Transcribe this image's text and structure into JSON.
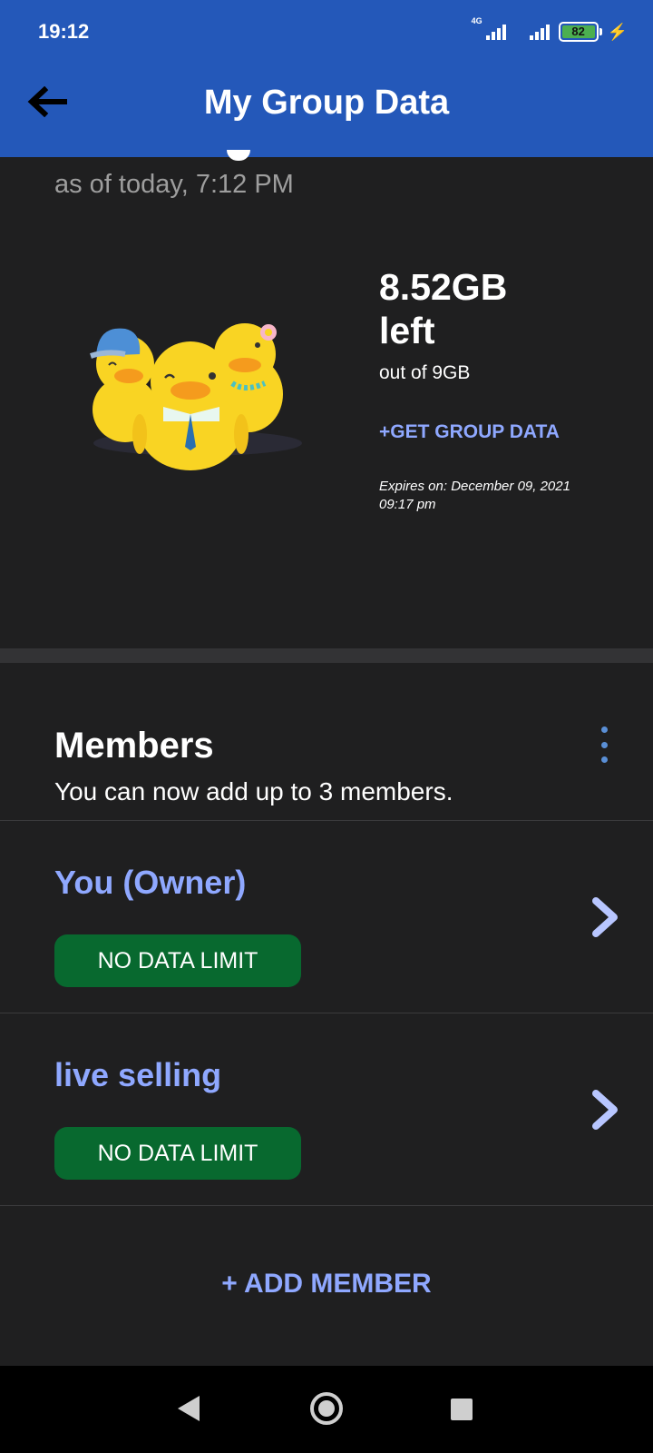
{
  "status_bar": {
    "time": "19:12",
    "network_type": "4G",
    "battery_level": "82"
  },
  "header": {
    "title": "My Group Data",
    "back_icon": "arrow-left-icon"
  },
  "summary": {
    "as_of": "as of today, 7:12 PM",
    "data_left_amount": "8.52GB",
    "data_left_suffix": "left",
    "out_of": "out of 9GB",
    "get_group_data_label": "+GET GROUP DATA",
    "expires": "Expires on: December 09, 2021 09:17 pm",
    "illustration": "three-ducks-illustration"
  },
  "members": {
    "title": "Members",
    "subtitle": "You can now add up to 3 members.",
    "menu_icon": "more-vertical-icon",
    "list": [
      {
        "name": "You (Owner)",
        "limit": "NO DATA LIMIT"
      },
      {
        "name": "live selling",
        "limit": "NO DATA LIMIT"
      }
    ],
    "add_member_label": "+ ADD MEMBER"
  },
  "colors": {
    "header_bg": "#2458b9",
    "page_bg": "#1f1f20",
    "accent_link": "#8fa8ff",
    "pill_green": "#08692f"
  }
}
